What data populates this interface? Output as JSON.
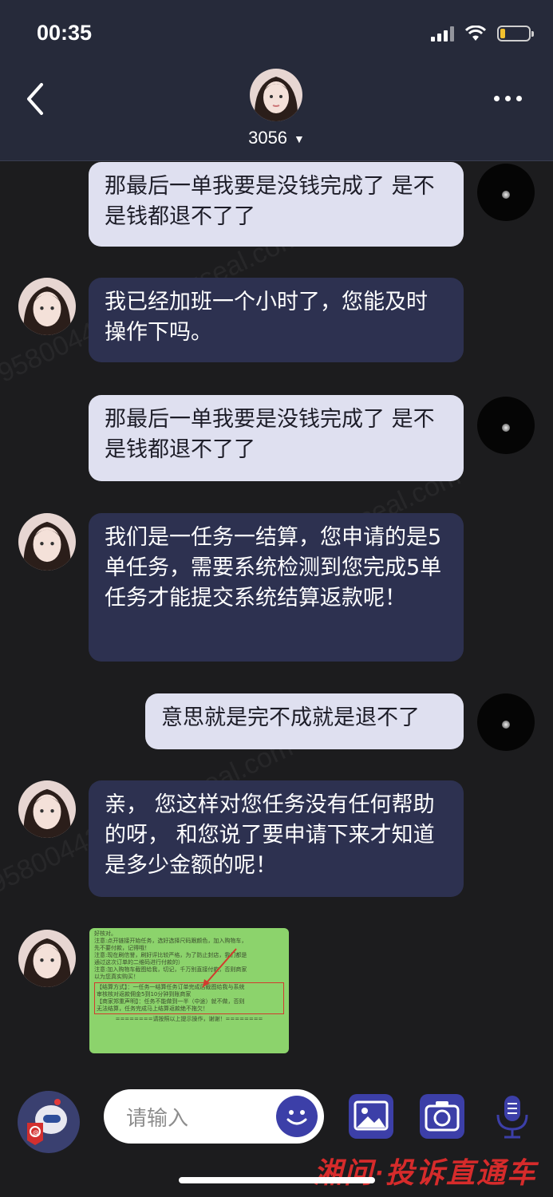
{
  "status": {
    "time": "00:35"
  },
  "header": {
    "contact_name": "3056"
  },
  "messages": [
    {
      "dir": "out",
      "text": "那最后一单我要是没钱完成了 是不是钱都退不了了"
    },
    {
      "dir": "in",
      "text": "我已经加班一个小时了，您能及时操作下吗。"
    },
    {
      "dir": "out",
      "text": "那最后一单我要是没钱完成了 是不是钱都退不了了"
    },
    {
      "dir": "in",
      "text": "我们是一任务一结算，您申请的是5单任务，需要系统检测到您完成5单任务才能提交系统结算返款呢！"
    },
    {
      "dir": "out",
      "text": "意思就是完不成就是退不了"
    },
    {
      "dir": "in",
      "text": "亲， 您这样对您任务没有任何帮助的呀， 和您说了要申请下来才知道是多少金额的呢！"
    }
  ],
  "image_message": {
    "lines": [
      "好核对。",
      "注意:点开链接开始任务，选好选择尺码跟颜色，加入购物车，",
      "先不要付款，记得哦！",
      "注意:现在刷信誉，刷好评比较严格，为了防止封店，我们都是",
      "通过这次订单的二维码进行付款的）",
      "注意:加入购物车截图给我，切记，千万别直接付款，否则商家",
      "以为您真实购买！"
    ],
    "boxed_lines": [
      "【结算方式】：一任务一结算任务订单完成后截图给我与系统",
      "审核核对返款佣金5到10分钟到账商家",
      "【商家郑重声明】：任务不能做到一半（中途）就不做，否则",
      "无法结算，任务完成马上结算返款绝不拖欠！"
    ],
    "footer": "========请按照以上提示操作，谢谢！========"
  },
  "composer": {
    "placeholder": "请输入"
  },
  "watermark": {
    "text": "95800443 5@msgseal.com"
  },
  "brand_footer": "湘问·投诉直通车",
  "colors": {
    "outgoing_bubble": "#dfe0f0",
    "incoming_bubble": "#2d3150",
    "accent": "#3c3fa8"
  }
}
